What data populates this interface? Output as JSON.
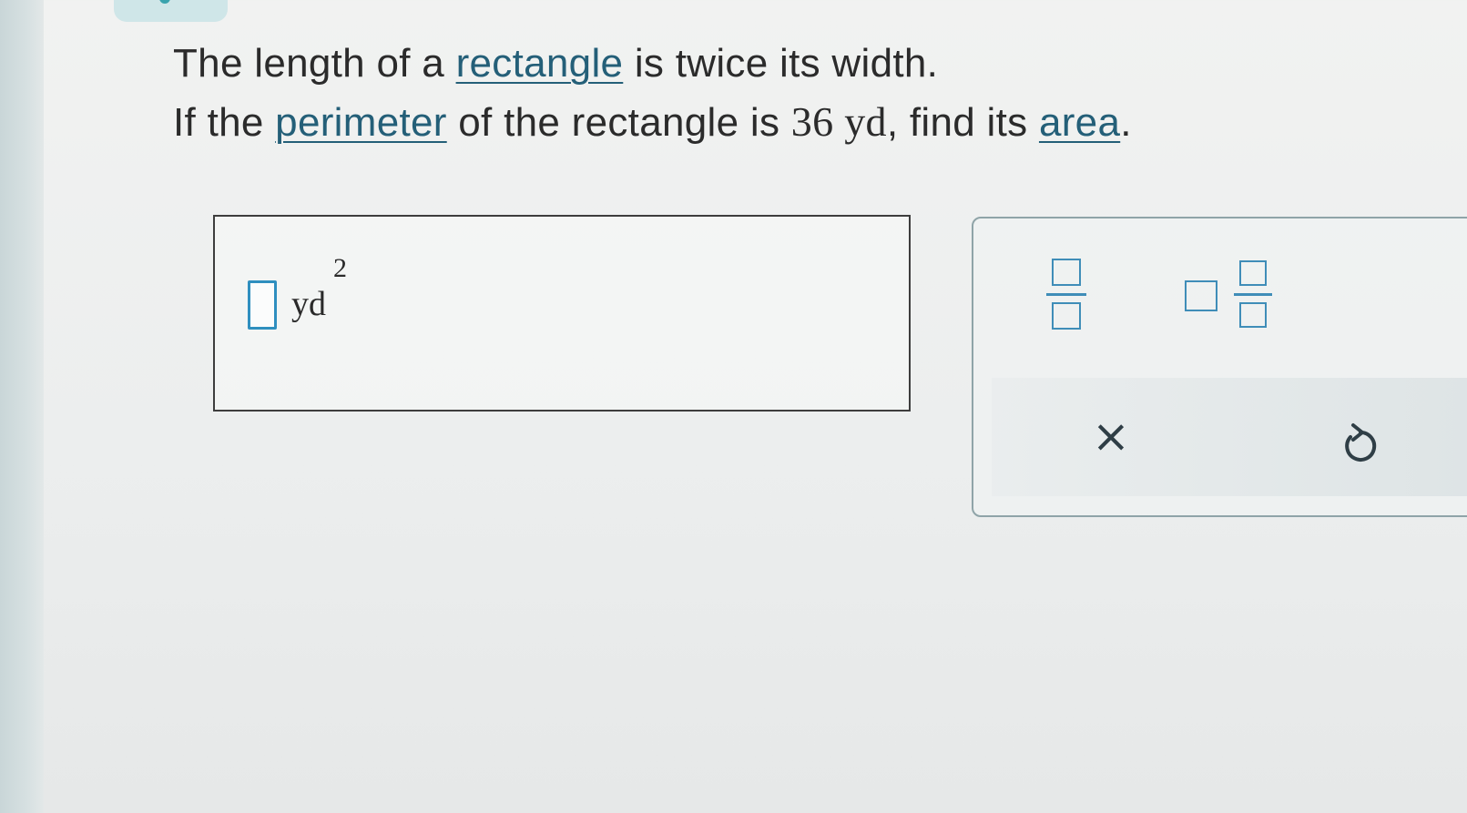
{
  "question": {
    "line1": {
      "before": "The length of a ",
      "term": "rectangle",
      "after": " is twice its width."
    },
    "line2": {
      "before": "If the ",
      "term_perimeter": "perimeter",
      "middle": " of the rectangle is ",
      "value": "36",
      "unit": " yd",
      "middle2": ", find its ",
      "term_area": "area",
      "end": "."
    }
  },
  "answer": {
    "value": "",
    "unit": "yd",
    "exponent": "2"
  },
  "toolpad": {
    "tools": [
      "fraction-icon",
      "mixed-number-icon",
      "clear-icon",
      "undo-icon"
    ],
    "clear_symbol": "×",
    "accent_color": "#3f8db8",
    "term_color": "#245f78",
    "input_border_color": "#2f8fbf"
  }
}
